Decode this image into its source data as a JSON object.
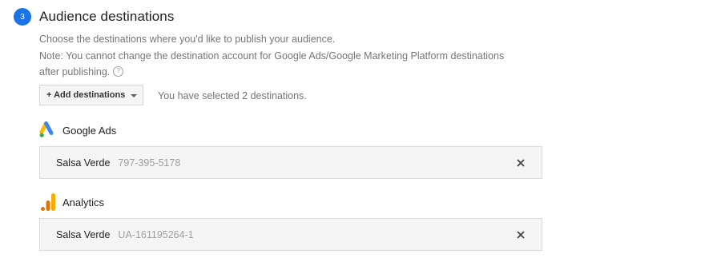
{
  "section": {
    "step_number": "3",
    "title": "Audience destinations",
    "description_line1": "Choose the destinations where you'd like to publish your audience.",
    "description_line2": "Note: You cannot change the destination account for Google Ads/Google Marketing Platform destinations",
    "description_line3": "after publishing.",
    "help_icon": "?"
  },
  "add_destinations": {
    "label": "+ Add destinations",
    "icon": "caret-down-icon"
  },
  "selected_summary": "You have selected 2 destinations.",
  "destinations": [
    {
      "type": "Google Ads",
      "icon": "google-ads-logo",
      "account_name": "Salsa Verde",
      "account_id": "797-395-5178"
    },
    {
      "type": "Analytics",
      "icon": "analytics-logo",
      "account_name": "Salsa Verde",
      "account_id": "UA-161195264-1"
    }
  ],
  "colors": {
    "accent": "#1a73e8",
    "google_ads_blue": "#4285f4",
    "google_ads_yellow": "#fbbc04",
    "google_ads_green": "#34a853",
    "analytics_orange": "#f9ab00",
    "analytics_dark_orange": "#e37400"
  }
}
